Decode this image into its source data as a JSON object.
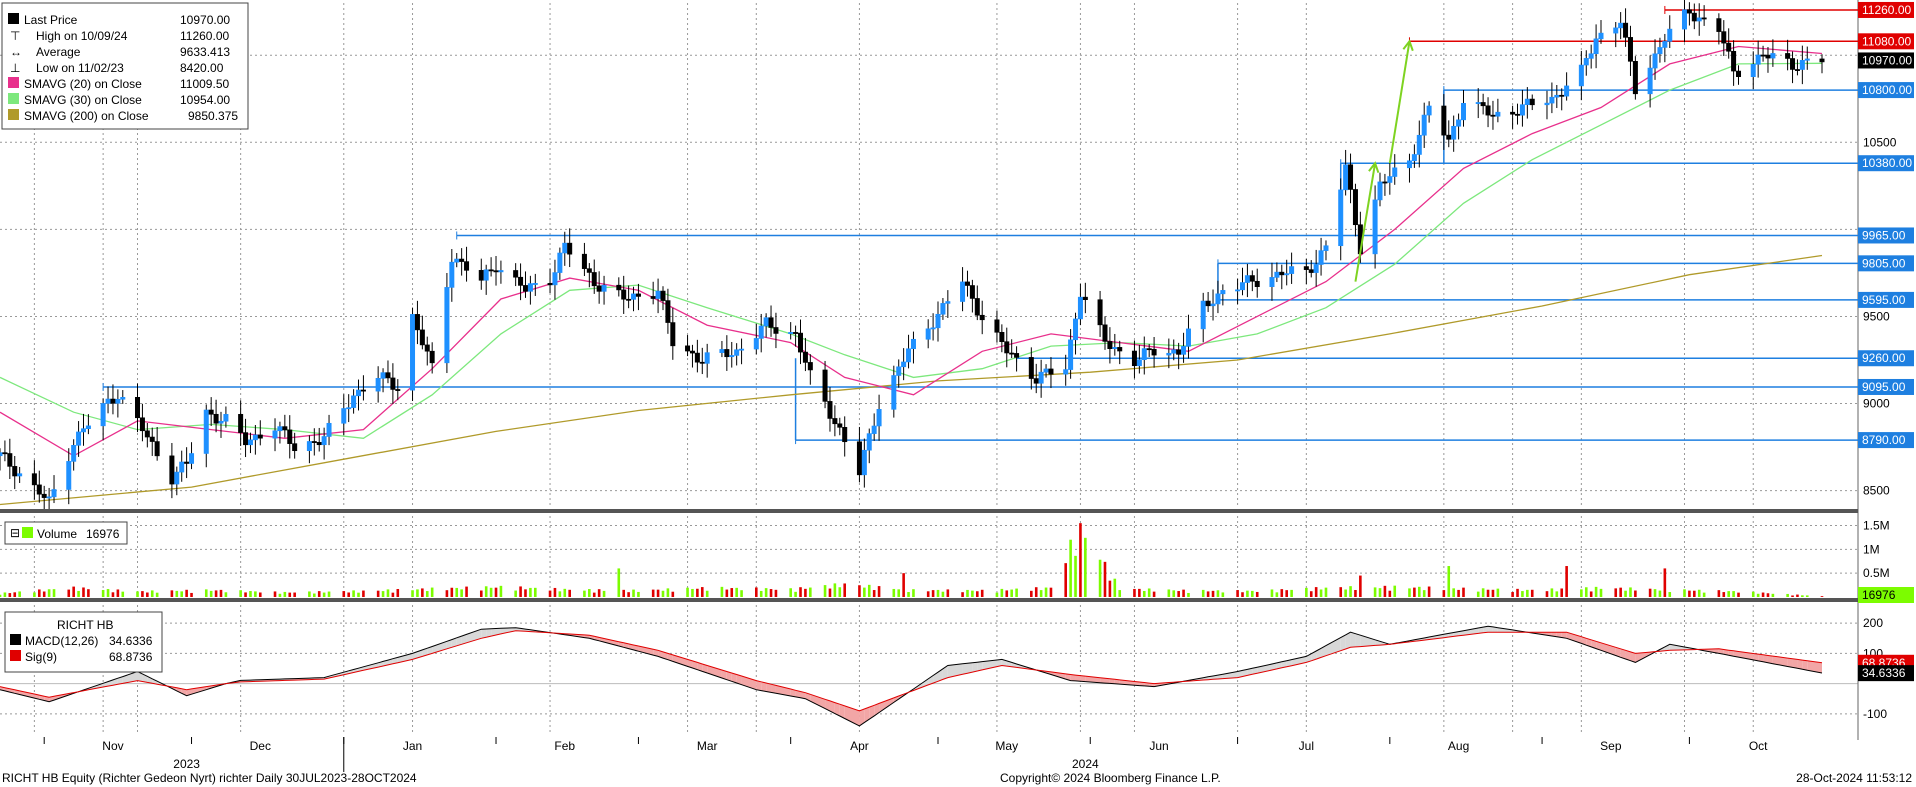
{
  "legend": {
    "last_price": {
      "label": "Last Price",
      "value": "10970.00"
    },
    "high": {
      "label": "High on 10/09/24",
      "value": "11260.00"
    },
    "average": {
      "label": "Average",
      "value": "9633.413"
    },
    "low": {
      "label": "Low on 11/02/23",
      "value": "8420.00"
    },
    "sma20": {
      "label": "SMAVG (20)  on Close",
      "value": "11009.50"
    },
    "sma30": {
      "label": "SMAVG (30)  on Close",
      "value": "10954.00"
    },
    "sma200": {
      "label": "SMAVG (200)  on Close",
      "value": "9850.375"
    }
  },
  "volume_legend": {
    "label": "Volume",
    "value": "16976"
  },
  "macd_legend": {
    "title": "RICHT HB",
    "macd": {
      "label": "MACD(12,26)",
      "value": "34.6336"
    },
    "sig": {
      "label": "Sig(9)",
      "value": "68.8736"
    }
  },
  "footer": {
    "left": "RICHT HB Equity (Richter Gedeon Nyrt) richter  Daily 30JUL2023-28OCT2024",
    "center": "Copyright© 2024 Bloomberg Finance L.P.",
    "right": "28-Oct-2024 11:53:12"
  },
  "months": [
    "Nov",
    "Dec",
    "Jan",
    "Feb",
    "Mar",
    "Apr",
    "May",
    "Jun",
    "Jul",
    "Aug",
    "Sep",
    "Oct"
  ],
  "years": [
    "2023",
    "2024"
  ],
  "colors": {
    "up": "#1e90ff",
    "down": "#000000",
    "sma20": "#e8308c",
    "sma30": "#7de87d",
    "sma200": "#b09a2a",
    "level": "#1e7fe0",
    "resist": "#e00000",
    "arrow": "#7ed321",
    "vol_up": "#7cfc00",
    "vol_down": "#e00000"
  },
  "chart_data": [
    {
      "type": "candlestick",
      "title": "RICHT HB Equity (Richter Gedeon Nyrt) richter  Daily 30JUL2023-28OCT2024",
      "ylim": [
        8400,
        11300
      ],
      "y_ticks": [
        8500,
        9000,
        9500,
        10500
      ],
      "price_labels": [
        11260.0,
        11080.0,
        10970.0,
        10800.0,
        10380.0,
        9965.0,
        9805.0,
        9595.0,
        9260.0,
        9095.0,
        8790.0
      ],
      "x_start": "2023-10-23",
      "x_end": "2024-10-28",
      "horizontal_levels": [
        {
          "value": 11260,
          "from": "2024-09-26",
          "color": "red"
        },
        {
          "value": 11080,
          "from": "2024-08-05",
          "color": "red"
        },
        {
          "value": 10800,
          "from": "2024-08-12",
          "color": "blue"
        },
        {
          "value": 10380,
          "from": "2024-07-22",
          "color": "blue"
        },
        {
          "value": 9965,
          "from": "2024-01-24",
          "color": "blue"
        },
        {
          "value": 9805,
          "from": "2024-06-27",
          "color": "blue"
        },
        {
          "value": 9595,
          "from": "2024-06-27",
          "color": "blue"
        },
        {
          "value": 9260,
          "from": "2024-05-17",
          "color": "blue"
        },
        {
          "value": 9095,
          "from": "2023-11-13",
          "color": "blue"
        },
        {
          "value": 8790,
          "from": "2024-04-02",
          "color": "blue"
        }
      ],
      "arrows": [
        {
          "from": [
            "2024-07-25",
            9700
          ],
          "to": [
            "2024-07-29",
            10380
          ]
        },
        {
          "from": [
            "2024-08-01",
            10380
          ],
          "to": [
            "2024-08-05",
            11080
          ]
        }
      ],
      "price_path": [
        [
          "2023-10-23",
          8700
        ],
        [
          "2023-10-27",
          8600
        ],
        [
          "2023-11-02",
          8430
        ],
        [
          "2023-11-07",
          8780
        ],
        [
          "2023-11-13",
          8980
        ],
        [
          "2023-11-16",
          9060
        ],
        [
          "2023-11-21",
          8850
        ],
        [
          "2023-11-27",
          8580
        ],
        [
          "2023-11-30",
          8650
        ],
        [
          "2023-12-04",
          8950
        ],
        [
          "2023-12-08",
          8900
        ],
        [
          "2023-12-12",
          8780
        ],
        [
          "2023-12-18",
          8870
        ],
        [
          "2023-12-22",
          8750
        ],
        [
          "2023-12-28",
          8800
        ],
        [
          "2024-01-03",
          9050
        ],
        [
          "2024-01-08",
          9150
        ],
        [
          "2024-01-12",
          9100
        ],
        [
          "2024-01-15",
          9500
        ],
        [
          "2024-01-19",
          9200
        ],
        [
          "2024-01-23",
          9850
        ],
        [
          "2024-01-29",
          9700
        ],
        [
          "2024-02-01",
          9800
        ],
        [
          "2024-02-07",
          9650
        ],
        [
          "2024-02-12",
          9720
        ],
        [
          "2024-02-15",
          9900
        ],
        [
          "2024-02-21",
          9700
        ],
        [
          "2024-02-27",
          9600
        ],
        [
          "2024-03-05",
          9650
        ],
        [
          "2024-03-08",
          9350
        ],
        [
          "2024-03-14",
          9250
        ],
        [
          "2024-03-21",
          9300
        ],
        [
          "2024-03-27",
          9450
        ],
        [
          "2024-04-02",
          9400
        ],
        [
          "2024-04-05",
          9150
        ],
        [
          "2024-04-11",
          8850
        ],
        [
          "2024-04-15",
          8600
        ],
        [
          "2024-04-19",
          9000
        ],
        [
          "2024-04-25",
          9300
        ],
        [
          "2024-05-02",
          9550
        ],
        [
          "2024-05-06",
          9700
        ],
        [
          "2024-05-10",
          9500
        ],
        [
          "2024-05-15",
          9300
        ],
        [
          "2024-05-21",
          9150
        ],
        [
          "2024-05-27",
          9200
        ],
        [
          "2024-05-30",
          9650
        ],
        [
          "2024-06-04",
          9350
        ],
        [
          "2024-06-10",
          9250
        ],
        [
          "2024-06-14",
          9300
        ],
        [
          "2024-06-19",
          9300
        ],
        [
          "2024-06-24",
          9550
        ],
        [
          "2024-06-28",
          9650
        ],
        [
          "2024-07-04",
          9700
        ],
        [
          "2024-07-10",
          9750
        ],
        [
          "2024-07-15",
          9750
        ],
        [
          "2024-07-19",
          9900
        ],
        [
          "2024-07-23",
          10350
        ],
        [
          "2024-07-26",
          9900
        ],
        [
          "2024-07-30",
          10250
        ],
        [
          "2024-08-05",
          10400
        ],
        [
          "2024-08-09",
          10700
        ],
        [
          "2024-08-13",
          10500
        ],
        [
          "2024-08-16",
          10750
        ],
        [
          "2024-08-22",
          10650
        ],
        [
          "2024-08-28",
          10700
        ],
        [
          "2024-09-03",
          10750
        ],
        [
          "2024-09-09",
          10900
        ],
        [
          "2024-09-12",
          11100
        ],
        [
          "2024-09-17",
          11200
        ],
        [
          "2024-09-20",
          10800
        ],
        [
          "2024-09-26",
          11100
        ],
        [
          "2024-10-01",
          11250
        ],
        [
          "2024-10-07",
          11150
        ],
        [
          "2024-10-10",
          10900
        ],
        [
          "2024-10-16",
          11000
        ],
        [
          "2024-10-22",
          10950
        ],
        [
          "2024-10-28",
          10970
        ]
      ],
      "sma20_path": [
        [
          "2023-10-23",
          8950
        ],
        [
          "2023-11-07",
          8700
        ],
        [
          "2023-11-20",
          8900
        ],
        [
          "2023-12-05",
          8850
        ],
        [
          "2023-12-20",
          8800
        ],
        [
          "2024-01-05",
          8850
        ],
        [
          "2024-01-19",
          9200
        ],
        [
          "2024-02-02",
          9600
        ],
        [
          "2024-02-16",
          9720
        ],
        [
          "2024-03-01",
          9650
        ],
        [
          "2024-03-15",
          9450
        ],
        [
          "2024-04-01",
          9350
        ],
        [
          "2024-04-12",
          9150
        ],
        [
          "2024-04-26",
          9050
        ],
        [
          "2024-05-10",
          9300
        ],
        [
          "2024-05-24",
          9400
        ],
        [
          "2024-06-07",
          9350
        ],
        [
          "2024-06-21",
          9300
        ],
        [
          "2024-07-05",
          9500
        ],
        [
          "2024-07-19",
          9700
        ],
        [
          "2024-08-02",
          10000
        ],
        [
          "2024-08-16",
          10350
        ],
        [
          "2024-08-30",
          10550
        ],
        [
          "2024-09-13",
          10700
        ],
        [
          "2024-09-27",
          10950
        ],
        [
          "2024-10-11",
          11050
        ],
        [
          "2024-10-28",
          11010
        ]
      ],
      "sma30_path": [
        [
          "2023-10-23",
          9150
        ],
        [
          "2023-11-07",
          8950
        ],
        [
          "2023-11-20",
          8850
        ],
        [
          "2023-12-05",
          8880
        ],
        [
          "2023-12-20",
          8850
        ],
        [
          "2024-01-05",
          8800
        ],
        [
          "2024-01-19",
          9050
        ],
        [
          "2024-02-02",
          9400
        ],
        [
          "2024-02-16",
          9650
        ],
        [
          "2024-03-01",
          9680
        ],
        [
          "2024-03-15",
          9550
        ],
        [
          "2024-04-01",
          9400
        ],
        [
          "2024-04-12",
          9280
        ],
        [
          "2024-04-26",
          9150
        ],
        [
          "2024-05-10",
          9200
        ],
        [
          "2024-05-24",
          9330
        ],
        [
          "2024-06-07",
          9350
        ],
        [
          "2024-06-21",
          9330
        ],
        [
          "2024-07-05",
          9400
        ],
        [
          "2024-07-19",
          9550
        ],
        [
          "2024-08-02",
          9800
        ],
        [
          "2024-08-16",
          10150
        ],
        [
          "2024-08-30",
          10400
        ],
        [
          "2024-09-13",
          10600
        ],
        [
          "2024-09-27",
          10800
        ],
        [
          "2024-10-11",
          10950
        ],
        [
          "2024-10-28",
          10954
        ]
      ],
      "sma200_path": [
        [
          "2023-10-23",
          8420
        ],
        [
          "2023-12-01",
          8520
        ],
        [
          "2024-01-01",
          8680
        ],
        [
          "2024-02-01",
          8840
        ],
        [
          "2024-03-01",
          8960
        ],
        [
          "2024-04-01",
          9050
        ],
        [
          "2024-05-01",
          9130
        ],
        [
          "2024-06-01",
          9180
        ],
        [
          "2024-07-01",
          9250
        ],
        [
          "2024-08-01",
          9400
        ],
        [
          "2024-09-01",
          9560
        ],
        [
          "2024-10-01",
          9740
        ],
        [
          "2024-10-28",
          9850
        ]
      ]
    },
    {
      "type": "bar",
      "title": "Volume",
      "ylim": [
        0,
        1700000
      ],
      "y_ticks": [
        "0.5M",
        "1M",
        "1.5M"
      ],
      "last_value": 16976,
      "volume_path": [
        [
          "2023-10-23",
          80000
        ],
        [
          "2023-11-07",
          200000
        ],
        [
          "2023-11-20",
          120000
        ],
        [
          "2023-12-05",
          150000
        ],
        [
          "2023-12-20",
          100000
        ],
        [
          "2024-01-05",
          130000
        ],
        [
          "2024-01-19",
          180000
        ],
        [
          "2024-02-02",
          220000
        ],
        [
          "2024-02-16",
          160000
        ],
        [
          "2024-03-01",
          140000
        ],
        [
          "2024-03-15",
          200000
        ],
        [
          "2024-04-01",
          170000
        ],
        [
          "2024-04-12",
          280000
        ],
        [
          "2024-04-26",
          150000
        ],
        [
          "2024-05-10",
          140000
        ],
        [
          "2024-05-24",
          200000
        ],
        [
          "2024-05-30",
          1550000
        ],
        [
          "2024-06-07",
          180000
        ],
        [
          "2024-06-21",
          140000
        ],
        [
          "2024-07-05",
          130000
        ],
        [
          "2024-07-19",
          200000
        ],
        [
          "2024-08-02",
          220000
        ],
        [
          "2024-08-16",
          180000
        ],
        [
          "2024-08-30",
          150000
        ],
        [
          "2024-09-13",
          200000
        ],
        [
          "2024-09-27",
          160000
        ],
        [
          "2024-10-11",
          120000
        ],
        [
          "2024-10-28",
          16976
        ]
      ],
      "volume_spikes": [
        [
          "2024-02-26",
          600000
        ],
        [
          "2024-04-24",
          500000
        ],
        [
          "2024-05-30",
          1550000
        ],
        [
          "2024-07-26",
          450000
        ],
        [
          "2024-08-13",
          650000
        ],
        [
          "2024-09-06",
          650000
        ],
        [
          "2024-09-26",
          600000
        ]
      ]
    },
    {
      "type": "area",
      "title": "RICHT HB",
      "ylim": [
        -170,
        260
      ],
      "y_ticks": [
        -100,
        100,
        200
      ],
      "series": [
        {
          "name": "MACD(12,26)",
          "last": 34.6336
        },
        {
          "name": "Sig(9)",
          "last": 68.8736
        }
      ],
      "macd_path": [
        [
          "2023-10-23",
          -20
        ],
        [
          "2023-11-02",
          -60
        ],
        [
          "2023-11-20",
          40
        ],
        [
          "2023-11-30",
          -40
        ],
        [
          "2023-12-10",
          10
        ],
        [
          "2023-12-28",
          20
        ],
        [
          "2024-01-15",
          100
        ],
        [
          "2024-01-29",
          180
        ],
        [
          "2024-02-05",
          185
        ],
        [
          "2024-02-20",
          150
        ],
        [
          "2024-03-05",
          90
        ],
        [
          "2024-03-25",
          -20
        ],
        [
          "2024-04-04",
          -50
        ],
        [
          "2024-04-15",
          -140
        ],
        [
          "2024-05-03",
          60
        ],
        [
          "2024-05-14",
          80
        ],
        [
          "2024-05-28",
          10
        ],
        [
          "2024-06-14",
          -10
        ],
        [
          "2024-07-01",
          40
        ],
        [
          "2024-07-15",
          90
        ],
        [
          "2024-07-24",
          170
        ],
        [
          "2024-08-01",
          130
        ],
        [
          "2024-08-21",
          190
        ],
        [
          "2024-09-06",
          150
        ],
        [
          "2024-09-20",
          70
        ],
        [
          "2024-09-27",
          130
        ],
        [
          "2024-10-07",
          100
        ],
        [
          "2024-10-28",
          35
        ]
      ],
      "signal_path": [
        [
          "2023-10-23",
          -10
        ],
        [
          "2023-11-02",
          -45
        ],
        [
          "2023-11-20",
          10
        ],
        [
          "2023-11-30",
          -20
        ],
        [
          "2023-12-10",
          5
        ],
        [
          "2023-12-28",
          15
        ],
        [
          "2024-01-15",
          80
        ],
        [
          "2024-01-29",
          150
        ],
        [
          "2024-02-05",
          175
        ],
        [
          "2024-02-20",
          160
        ],
        [
          "2024-03-05",
          110
        ],
        [
          "2024-03-25",
          10
        ],
        [
          "2024-04-04",
          -30
        ],
        [
          "2024-04-15",
          -90
        ],
        [
          "2024-05-03",
          20
        ],
        [
          "2024-05-14",
          60
        ],
        [
          "2024-05-28",
          30
        ],
        [
          "2024-06-14",
          0
        ],
        [
          "2024-07-01",
          20
        ],
        [
          "2024-07-15",
          70
        ],
        [
          "2024-07-24",
          120
        ],
        [
          "2024-08-01",
          130
        ],
        [
          "2024-08-21",
          170
        ],
        [
          "2024-09-06",
          170
        ],
        [
          "2024-09-20",
          100
        ],
        [
          "2024-09-27",
          110
        ],
        [
          "2024-10-07",
          115
        ],
        [
          "2024-10-28",
          69
        ]
      ]
    }
  ]
}
